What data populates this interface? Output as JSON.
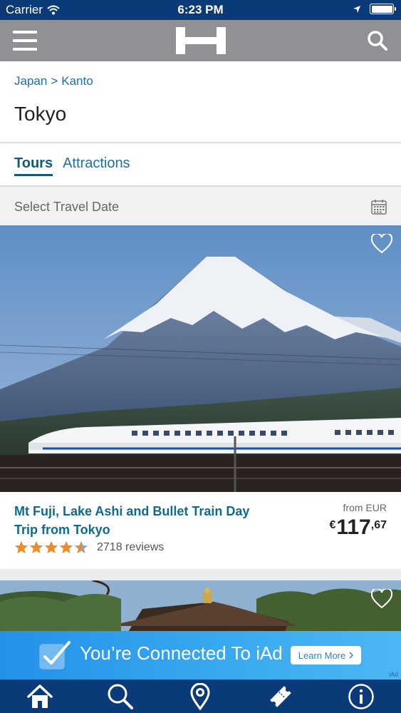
{
  "status_bar": {
    "carrier": "Carrier",
    "time": "6:23 PM"
  },
  "nav": {
    "menu_icon": "hamburger-menu-icon",
    "logo_icon": "hostelworld-h-logo",
    "search_icon": "search-icon"
  },
  "breadcrumb": {
    "items": [
      "Japan",
      "Kanto"
    ],
    "separator": ">"
  },
  "page_title": "Tokyo",
  "tabs": [
    {
      "label": "Tours",
      "active": true
    },
    {
      "label": "Attractions",
      "active": false
    }
  ],
  "date_picker": {
    "placeholder": "Select Travel Date",
    "icon": "calendar-icon"
  },
  "tour": {
    "title": "Mt Fuji, Lake Ashi and Bullet Train Day Trip from Tokyo",
    "rating": 4.5,
    "reviews": "2718 reviews",
    "price_from": "from EUR",
    "currency_symbol": "€",
    "price_main": "117",
    "price_cents": ",67"
  },
  "iad": {
    "text": "You’re Connected To iAd",
    "button": "Learn More",
    "tag": "iAd"
  },
  "tab_bar": {
    "items": [
      "home-icon",
      "search-icon",
      "location-pin-icon",
      "ticket-icon",
      "info-icon"
    ]
  },
  "colors": {
    "status_bar": "#0a3a78",
    "nav_bar": "#8f9194",
    "link": "#1f6fa3",
    "tour_title": "#0e6a8f",
    "star": "#f08a24",
    "iad": "#2591e8"
  }
}
